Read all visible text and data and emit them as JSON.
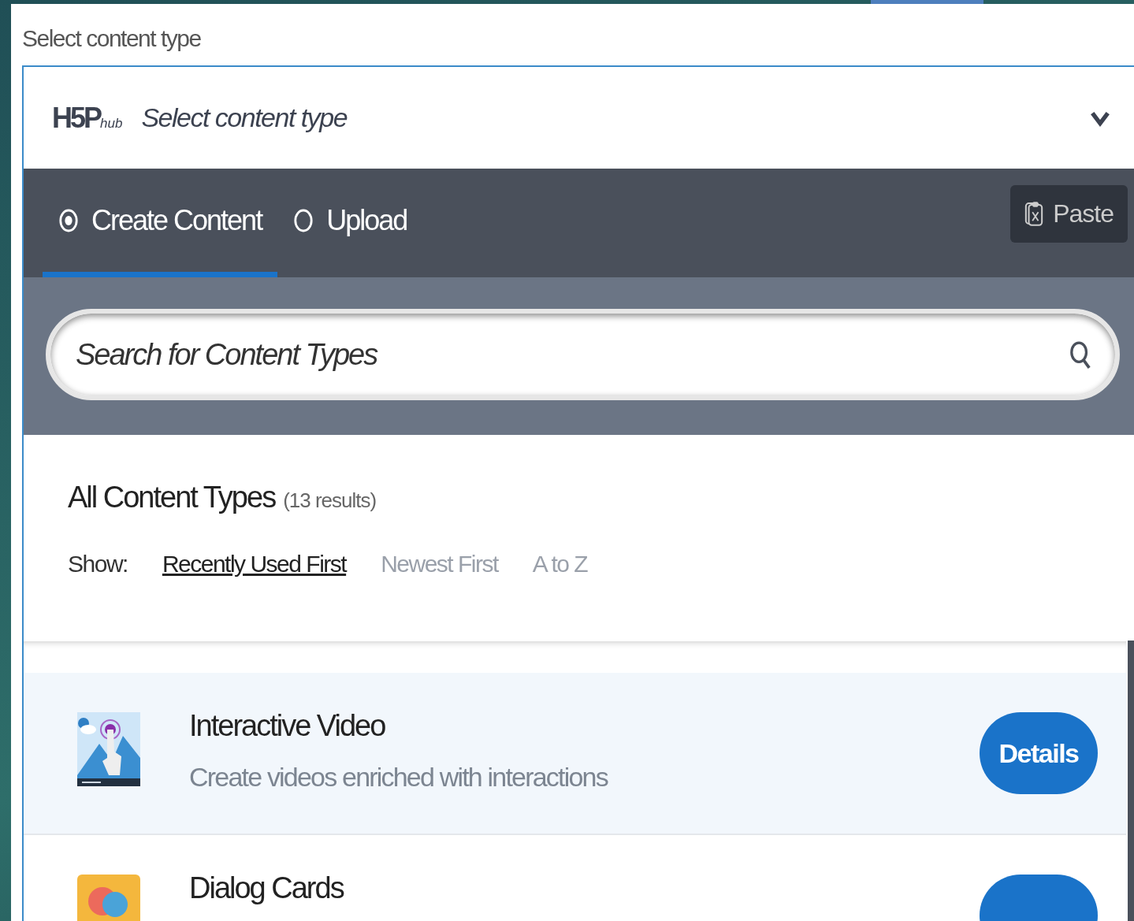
{
  "field_label": "Select content type",
  "header": {
    "logo": {
      "main": "H5P",
      "sub": "hub"
    },
    "title": "Select content type",
    "expanded": true
  },
  "tabs": [
    {
      "label": "Create Content",
      "selected": true
    },
    {
      "label": "Upload",
      "selected": false
    }
  ],
  "paste_button": "Paste",
  "search": {
    "placeholder": "Search for Content Types"
  },
  "results": {
    "title": "All Content Types",
    "count": "(13 results)",
    "show_label": "Show:",
    "sort_options": [
      {
        "label": "Recently Used First",
        "selected": true
      },
      {
        "label": "Newest First",
        "selected": false
      },
      {
        "label": "A to Z",
        "selected": false
      }
    ]
  },
  "content_types": [
    {
      "kind": "video",
      "title": "Interactive Video",
      "summary": "Create videos enriched with interactions",
      "button": "Details",
      "highlighted": true
    },
    {
      "kind": "cards",
      "title": "Dialog Cards",
      "highlighted": false
    }
  ]
}
